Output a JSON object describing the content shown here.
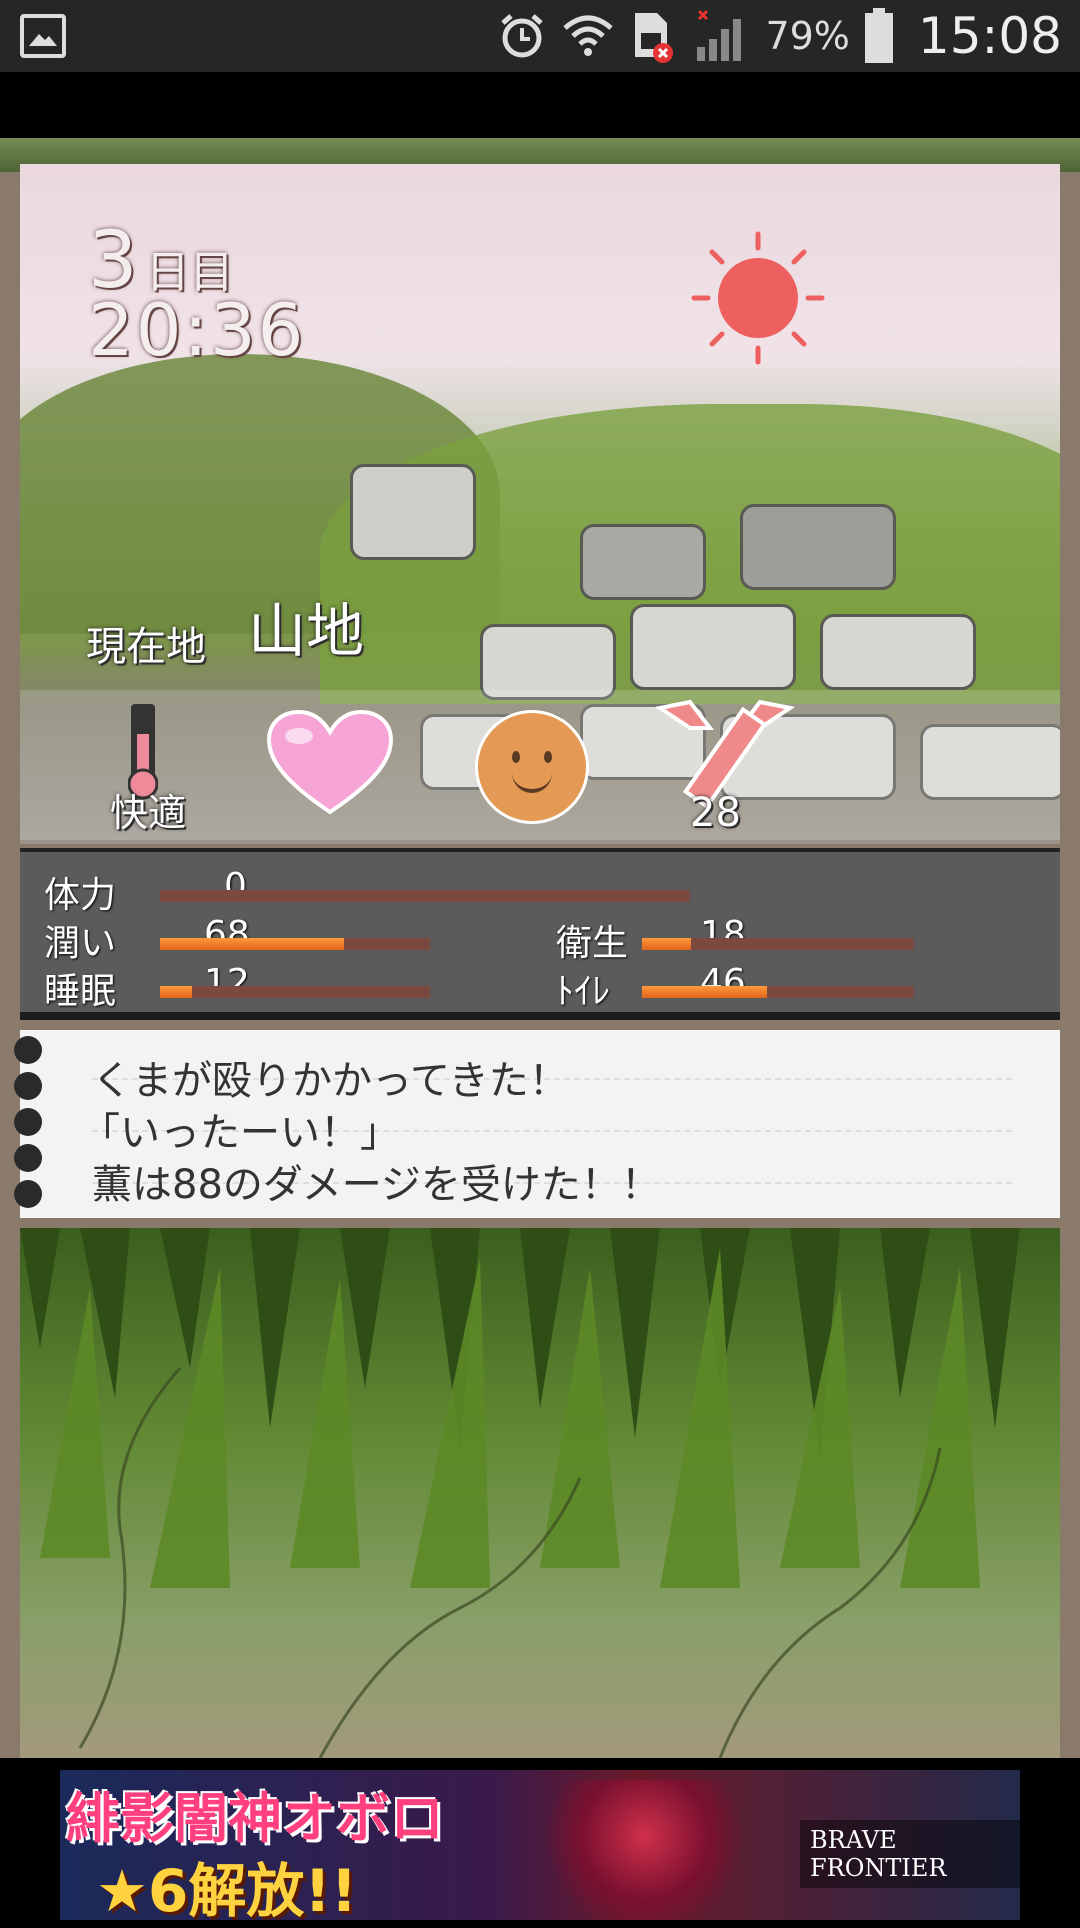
{
  "status_bar": {
    "icons": [
      "image-icon",
      "alarm-icon",
      "wifi-icon",
      "sim-error-icon",
      "signal-icon",
      "battery-icon"
    ],
    "battery": "79%",
    "time": "15:08"
  },
  "scene": {
    "day_number": "3",
    "day_unit": "日目",
    "clock": "20:36",
    "weather_icon": "sun-icon",
    "location_label": "現在地",
    "location": "山地"
  },
  "indicators": {
    "temperature_label": "快適",
    "heart_icon": "heart-icon",
    "mood_icon": "smiley-face-icon",
    "weapon_icon": "spear-icon",
    "weapon_count": "28"
  },
  "stats": {
    "stamina": {
      "label": "体力",
      "value": "0",
      "fraction": 0.0
    },
    "moisture": {
      "label": "潤い",
      "value": "68",
      "fraction": 0.68
    },
    "sleep": {
      "label": "睡眠",
      "value": "12",
      "fraction": 0.12
    },
    "hygiene": {
      "label": "衛生",
      "value": "18",
      "fraction": 0.18
    },
    "toilet": {
      "label": "ﾄｲﾚ",
      "value": "46",
      "fraction": 0.46
    }
  },
  "message_log": {
    "lines": [
      "くまが殴りかかってきた！",
      "「いったーい！」",
      "薫は88のダメージを受けた！！"
    ]
  },
  "ad": {
    "title": "緋影闇神オボロ",
    "subtitle": "★6解放!!",
    "brand": "BRAVE FRONTIER"
  },
  "colors": {
    "bar_fill": "#f07a28",
    "bar_track": "#7a4a3e",
    "sun": "#ee5f5f",
    "heart": "#f6a3d6",
    "face": "#e49a55"
  }
}
